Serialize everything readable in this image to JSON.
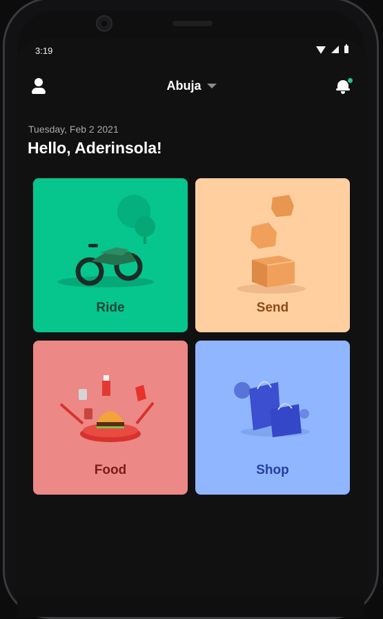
{
  "status_bar": {
    "time": "3:19"
  },
  "header": {
    "location": "Abuja"
  },
  "greeting": {
    "date": "Tuesday, Feb 2 2021",
    "message": "Hello, Aderinsola!"
  },
  "services": [
    {
      "label": "Ride",
      "color": "#06c68d"
    },
    {
      "label": "Send",
      "color": "#ffcf9f"
    },
    {
      "label": "Food",
      "color": "#ec8886"
    },
    {
      "label": "Shop",
      "color": "#8fb6ff"
    }
  ],
  "colors": {
    "background": "#111112",
    "notification_dot": "#22c48f"
  },
  "icons": [
    "profile-icon",
    "chevron-down-icon",
    "bell-icon",
    "wifi-icon",
    "signal-icon",
    "battery-icon"
  ]
}
